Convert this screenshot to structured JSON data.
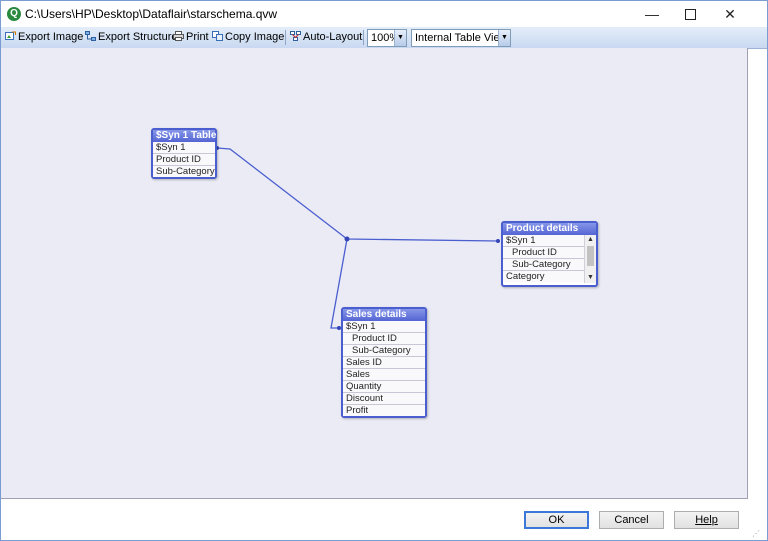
{
  "window": {
    "title": "C:\\Users\\HP\\Desktop\\Dataflair\\starschema.qvw",
    "app_icon_letter": "Q",
    "minimize_glyph": "—",
    "close_glyph": "✕"
  },
  "toolbar": {
    "export_image": "Export Image",
    "export_structure": "Export Structure",
    "print": "Print",
    "copy_image": "Copy Image",
    "auto_layout": "Auto-Layout",
    "zoom_value": "100%",
    "view_value": "Internal Table View",
    "dropdown_glyph": "▼"
  },
  "tables": {
    "syn": {
      "title": "$Syn 1 Table",
      "fields": [
        "$Syn 1",
        "Product ID",
        "Sub-Category"
      ]
    },
    "product": {
      "title": "Product details",
      "fields": [
        "$Syn 1",
        "Product ID",
        "Sub-Category",
        "Category"
      ]
    },
    "sales": {
      "title": "Sales details",
      "fields": [
        "$Syn 1",
        "Product ID",
        "Sub-Category",
        "Sales ID",
        "Sales",
        "Quantity",
        "Discount",
        "Profit"
      ]
    }
  },
  "scroll": {
    "up_glyph": "▲",
    "down_glyph": "▼"
  },
  "buttons": {
    "ok": "OK",
    "cancel": "Cancel",
    "help": "Help"
  },
  "colors": {
    "link_line": "#4a5ed0",
    "table_header": "#5465d4",
    "canvas": "#ebebf5"
  }
}
